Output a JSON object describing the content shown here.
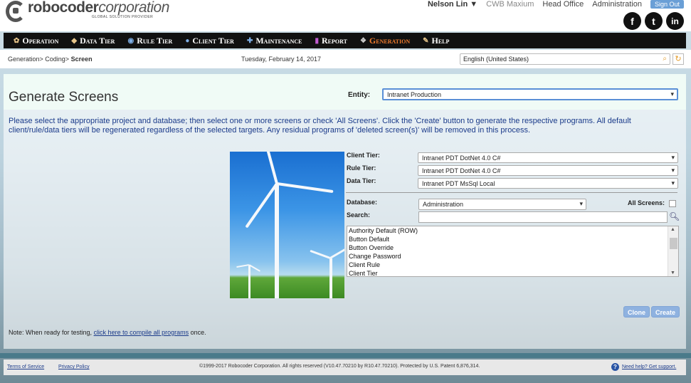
{
  "brand": {
    "name_bold": "robocoder",
    "name_rest": "corporation",
    "tagline": "GLOBAL SOLUTION PROVIDER"
  },
  "topnav": {
    "user": "Nelson Lin ▼",
    "company": "CWB Maxium",
    "office": "Head Office",
    "admin": "Administration",
    "signout": "Sign Out"
  },
  "social": {
    "facebook": "f",
    "twitter": "t",
    "linkedin": "in"
  },
  "menu": [
    {
      "label": "Operation",
      "icon": "gear-icon"
    },
    {
      "label": "Data Tier",
      "icon": "database-icon"
    },
    {
      "label": "Rule Tier",
      "icon": "rule-icon"
    },
    {
      "label": "Client Tier",
      "icon": "client-icon"
    },
    {
      "label": "Maintenance",
      "icon": "wrench-icon"
    },
    {
      "label": "Report",
      "icon": "report-icon"
    },
    {
      "label": "Generation",
      "icon": "generation-icon",
      "active": true
    },
    {
      "label": "Help",
      "icon": "help-icon"
    }
  ],
  "breadcrumb": {
    "part1": "Generation> Coding> ",
    "current": "Screen"
  },
  "date": "Tuesday, February 14, 2017",
  "language": "English (United States)",
  "page": {
    "title": "Generate Screens",
    "entity_label": "Entity:",
    "entity_value": "Intranet Production",
    "description": "Please select the appropriate project and database; then select one or more screens or check 'All Screens'. Click the 'Create' button to generate the respective programs. All default client/rule/data tiers will be regenerated regardless of the selected targets. Any residual programs of 'deleted screen(s)' will be removed in this process."
  },
  "form": {
    "client_tier_label": "Client Tier:",
    "client_tier_value": "Intranet PDT DotNet 4.0 C#",
    "rule_tier_label": "Rule Tier:",
    "rule_tier_value": "Intranet PDT DotNet 4.0 C#",
    "data_tier_label": "Data Tier:",
    "data_tier_value": "Intranet PDT MsSql Local",
    "database_label": "Database:",
    "database_value": "Administration",
    "all_screens_label": "All Screens:",
    "search_label": "Search:",
    "search_value": "",
    "screens": [
      "Authority Default (ROW)",
      "Button Default",
      "Button Override",
      "Change Password",
      "Client Rule",
      "Client Tier"
    ]
  },
  "buttons": {
    "clone": "Clone",
    "create": "Create"
  },
  "note": {
    "prefix": "Note: When ready for testing, ",
    "link": "click here to compile all programs",
    "suffix": " once."
  },
  "footer": {
    "terms": "Terms of Service",
    "privacy": "Privacy Policy",
    "copyright": "©1999-2017 Robocoder Corporation. All rights reserved (V10.47.70210 by R10.47.70210). Protected by U.S. Patent 6,876,314.",
    "help": "Need help? Get support."
  }
}
